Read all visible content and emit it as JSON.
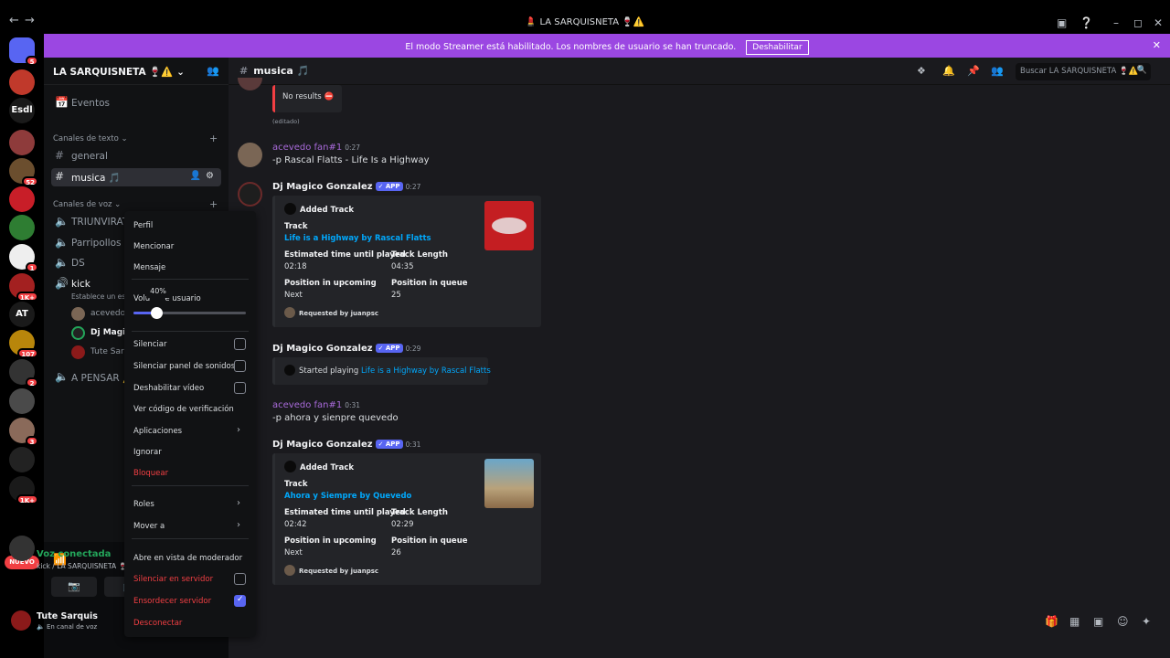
{
  "window": {
    "title": "💄 LA SARQUISNETA 🍷⚠️",
    "back": "←",
    "forward": "→"
  },
  "banner": {
    "text": "El modo Streamer está habilitado. Los nombres de usuario se han truncado.",
    "button": "Deshabilitar",
    "close": "✕"
  },
  "servers": [
    {
      "label": "",
      "badge": "5",
      "color": "#5865f2"
    },
    {
      "label": "",
      "badge": "",
      "color": "#c0392b"
    },
    {
      "label": "Esdl",
      "badge": "",
      "color": "#1a1a1a"
    },
    {
      "label": "",
      "badge": "",
      "color": "#8e3b3b"
    },
    {
      "label": "",
      "badge": "52",
      "color": "#6b4e2e"
    },
    {
      "label": "",
      "badge": "",
      "color": "#c81e28"
    },
    {
      "label": "",
      "badge": "",
      "color": "#2e7d32"
    },
    {
      "label": "",
      "badge": "1",
      "color": "#eeeeee"
    },
    {
      "label": "",
      "badge": "1K+",
      "color": "#a32020"
    },
    {
      "label": "AT",
      "badge": "",
      "color": "#1a1a1a"
    },
    {
      "label": "",
      "badge": "107",
      "color": "#b8860b"
    },
    {
      "label": "",
      "badge": "2",
      "color": "#333333"
    },
    {
      "label": "",
      "badge": "",
      "color": "#4a4a4a"
    },
    {
      "label": "",
      "badge": "3",
      "color": "#8a6a5a"
    },
    {
      "label": "",
      "badge": "",
      "color": "#222222"
    },
    {
      "label": "",
      "badge": "1K+",
      "color": "#1a1a1a"
    }
  ],
  "nuevo": "NUEVO",
  "sidebar": {
    "server_name": "LA SARQUISNETA 🍷⚠️",
    "events": "Eventos",
    "text_category": "Canales de texto",
    "voice_category": "Canales de voz",
    "channels": [
      {
        "name": "general"
      },
      {
        "name": "musica 🎵"
      }
    ],
    "voice_channels": [
      {
        "name": "TRIUNVIRAT"
      },
      {
        "name": "Parripollos N"
      },
      {
        "name": "DS"
      },
      {
        "name": "kick"
      },
      {
        "name": "A PENSAR ⚠️"
      }
    ],
    "kick_status": "Establece un est",
    "voice_members": [
      {
        "name": "acevedo"
      },
      {
        "name": "Dj Magico"
      },
      {
        "name": "Tute Sarqu"
      }
    ],
    "voice_connected": "Voz conectada",
    "voice_location": "kick / LA SARQUISNETA 🍷",
    "user_name": "Tute Sarquis",
    "user_status": "En canal de voz"
  },
  "channel": {
    "name": "musica 🎵",
    "search_placeholder": "Buscar LA SARQUISNETA 🍷⚠️"
  },
  "messages": {
    "prev_embed": "No results ⛔",
    "prev_edited": "(editado)",
    "m1": {
      "author": "acevedo fan#1",
      "time": "0:27",
      "text": "-p Rascal Flatts - Life Is a Highway"
    },
    "m2": {
      "author": "Dj Magico Gonzalez",
      "app": "✓ APP",
      "time": "0:27",
      "embed": {
        "title": "Added Track",
        "track_label": "Track",
        "track": "Life is a Highway by Rascal Flatts",
        "est_label": "Estimated time until played",
        "est": "02:18",
        "len_label": "Track Length",
        "len": "04:35",
        "pos_up_label": "Position in upcoming",
        "pos_up": "Next",
        "pos_q_label": "Position in queue",
        "pos_q": "25",
        "footer": "Requested by juanpsc"
      }
    },
    "m3": {
      "author": "Dj Magico Gonzalez",
      "app": "✓ APP",
      "time": "0:29",
      "text": "Started playing",
      "link": "Life is a Highway by Rascal Flatts"
    },
    "m4": {
      "author": "acevedo fan#1",
      "time": "0:31",
      "text": "-p ahora y sienpre quevedo"
    },
    "m5": {
      "author": "Dj Magico Gonzalez",
      "app": "✓ APP",
      "time": "0:31",
      "embed": {
        "title": "Added Track",
        "track_label": "Track",
        "track": "Ahora y Siempre by Quevedo",
        "est_label": "Estimated time until played",
        "est": "02:42",
        "len_label": "Track Length",
        "len": "02:29",
        "pos_up_label": "Position in upcoming",
        "pos_up": "Next",
        "pos_q_label": "Position in queue",
        "pos_q": "26",
        "footer": "Requested by juanpsc"
      }
    }
  },
  "context_menu": {
    "perfil": "Perfil",
    "mencionar": "Mencionar",
    "mensaje": "Mensaje",
    "volume_label_a": "Volu",
    "volume_label_b": "e usuario",
    "volume_tooltip": "40%",
    "volume_level": 0.2,
    "silenciar": "Silenciar",
    "silenciar_sonidos": "Silenciar panel de sonidos",
    "deshabilitar_video": "Deshabilitar vídeo",
    "ver_codigo": "Ver código de verificación",
    "aplicaciones": "Aplicaciones",
    "ignorar": "Ignorar",
    "bloquear": "Bloquear",
    "roles": "Roles",
    "mover": "Mover a",
    "moderador": "Abre en vista de moderador",
    "silenciar_servidor": "Silenciar en servidor",
    "ensordecer_servidor": "Ensordecer servidor",
    "desconectar": "Desconectar"
  },
  "colors": {
    "accent": "#5865f2",
    "banner": "#9b47e2",
    "danger": "#f23f43",
    "link": "#00a8fc",
    "author_purple": "#a86ad9"
  }
}
